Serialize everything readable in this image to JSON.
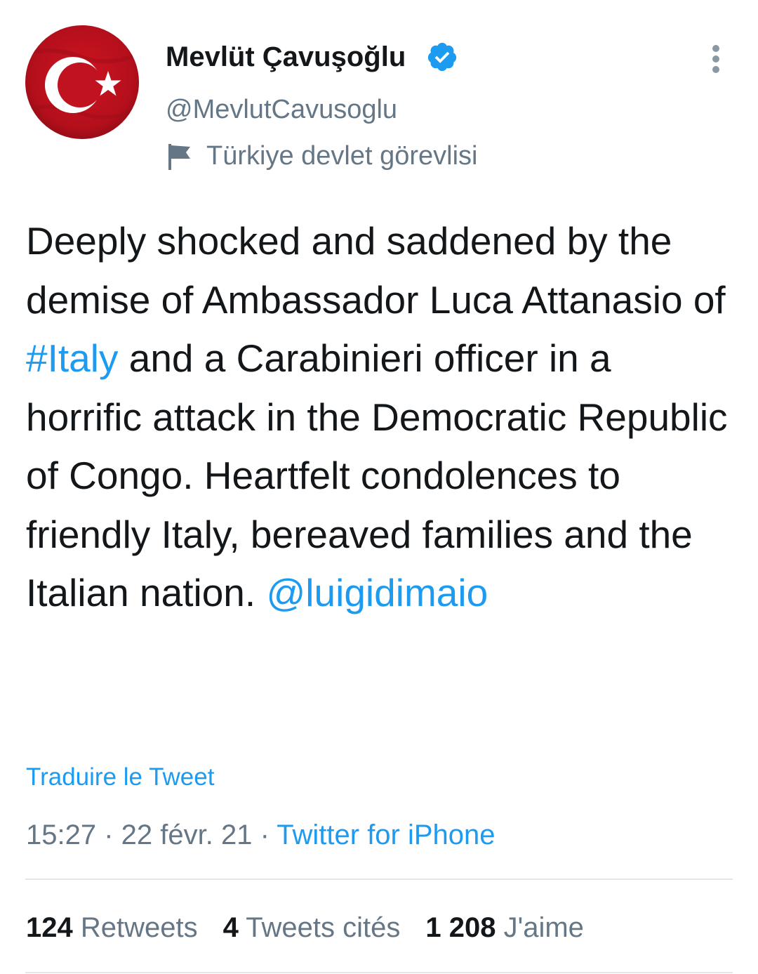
{
  "user": {
    "display_name": "Mevlüt Çavuşoğlu",
    "handle": "@MevlutCavusoglu",
    "label": "Türkiye devlet görevlisi",
    "verified_icon": "verified-badge-icon",
    "avatar_colors": {
      "red": "#c1121f",
      "white": "#ffffff"
    }
  },
  "tweet": {
    "text_before_hashtag": "Deeply shocked and saddened by the demise of Ambassador Luca Attanasio of ",
    "hashtag": "#Italy",
    "text_after_hashtag": " and a Carabinieri officer in a horrific attack in the Democratic Republic of Congo. Heartfelt condolences to friendly Italy, bereaved families and the Italian nation. ",
    "mention": "@luigidimaio",
    "translate_label": "Traduire le Tweet"
  },
  "meta": {
    "time": "15:27",
    "separator": " · ",
    "date": "22 févr. 21",
    "source": "Twitter for iPhone"
  },
  "stats": {
    "retweets_count": "124",
    "retweets_label": "Retweets",
    "quotes_count": "4",
    "quotes_label": "Tweets cités",
    "likes_count": "1 208",
    "likes_label": "J'aime"
  },
  "colors": {
    "link": "#1d9bf0",
    "secondary_text": "#657786",
    "primary_text": "#14171a",
    "divider": "#e1e8ed"
  }
}
